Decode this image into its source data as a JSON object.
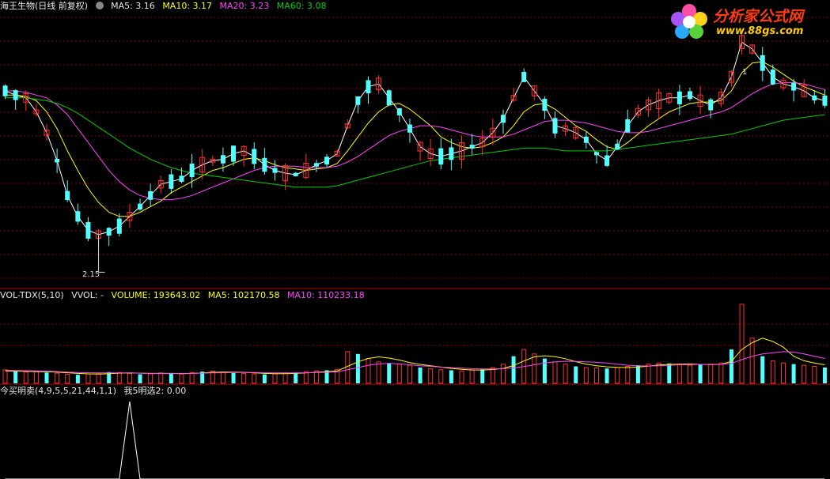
{
  "header_main": {
    "stock_title": "海王生物(日线 前复权)",
    "ma5": "MA5: 3.16",
    "ma10": "MA10: 3.17",
    "ma20": "MA20: 3.23",
    "ma60": "MA60: 3.08"
  },
  "header_volume": {
    "indicator": "VOL-TDX(5,10)",
    "vvol": "VVOL: -",
    "volume": "VOLUME: 193643.02",
    "ma5": "MA5: 102170.58",
    "ma10": "MA10: 110233.18"
  },
  "header_indicator": {
    "name": "今买明卖(4,9,5,5,21,44,1,1)",
    "value": "我5明选2: 0.00"
  },
  "logo": {
    "text": "分析家公式网",
    "url": "www.88gs.com"
  },
  "annotations": {
    "low": "2.15",
    "high": "1"
  },
  "colors": {
    "up": "#ff3030",
    "down": "#54ffff",
    "ma5": "#ffffff",
    "ma10": "#ffff00",
    "ma20": "#ff44ff",
    "ma60": "#00d000",
    "grid": "#8b0000",
    "divider": "#c00000"
  },
  "chart_data": [
    {
      "type": "candlestick",
      "title": "海王生物(日线 前复权)",
      "series": [
        {
          "name": "MA5",
          "color": "#ffffff",
          "values": [
            3.45,
            3.42,
            3.4,
            3.3,
            3.15,
            2.95,
            2.7,
            2.55,
            2.45,
            2.42,
            2.44,
            2.48,
            2.55,
            2.62,
            2.7,
            2.78,
            2.8,
            2.82,
            2.88,
            2.92,
            2.95,
            2.96,
            3.0,
            3.02,
            2.98,
            2.92,
            2.88,
            2.86,
            2.85,
            2.88,
            2.92,
            2.95,
            3.0,
            3.2,
            3.38,
            3.48,
            3.5,
            3.4,
            3.3,
            3.18,
            3.05,
            3.0,
            2.98,
            3.0,
            3.02,
            3.05,
            3.08,
            3.15,
            3.25,
            3.4,
            3.55,
            3.45,
            3.35,
            3.2,
            3.18,
            3.15,
            3.1,
            3.0,
            2.95,
            3.05,
            3.2,
            3.3,
            3.35,
            3.38,
            3.4,
            3.4,
            3.42,
            3.38,
            3.35,
            3.4,
            3.55,
            3.8,
            3.75,
            3.65,
            3.55,
            3.5,
            3.48,
            3.45,
            3.4,
            3.38
          ]
        },
        {
          "name": "MA10",
          "color": "#ffff00",
          "values": [
            3.42,
            3.42,
            3.41,
            3.38,
            3.3,
            3.18,
            3.02,
            2.88,
            2.75,
            2.65,
            2.58,
            2.55,
            2.55,
            2.58,
            2.62,
            2.66,
            2.72,
            2.76,
            2.8,
            2.84,
            2.88,
            2.9,
            2.93,
            2.96,
            2.97,
            2.95,
            2.92,
            2.9,
            2.89,
            2.88,
            2.89,
            2.9,
            2.93,
            3.02,
            3.12,
            3.22,
            3.3,
            3.35,
            3.36,
            3.32,
            3.26,
            3.2,
            3.12,
            3.08,
            3.05,
            3.04,
            3.05,
            3.08,
            3.12,
            3.2,
            3.3,
            3.35,
            3.36,
            3.32,
            3.26,
            3.2,
            3.16,
            3.1,
            3.05,
            3.03,
            3.08,
            3.14,
            3.2,
            3.25,
            3.3,
            3.33,
            3.36,
            3.37,
            3.37,
            3.38,
            3.45,
            3.58,
            3.65,
            3.66,
            3.62,
            3.57,
            3.52,
            3.48,
            3.45,
            3.42
          ]
        },
        {
          "name": "MA20",
          "color": "#ff44ff",
          "values": [
            3.45,
            3.45,
            3.44,
            3.42,
            3.4,
            3.35,
            3.28,
            3.18,
            3.08,
            2.98,
            2.88,
            2.8,
            2.74,
            2.7,
            2.68,
            2.67,
            2.67,
            2.68,
            2.7,
            2.73,
            2.76,
            2.79,
            2.82,
            2.85,
            2.88,
            2.9,
            2.91,
            2.91,
            2.91,
            2.9,
            2.9,
            2.9,
            2.91,
            2.94,
            2.98,
            3.03,
            3.08,
            3.13,
            3.16,
            3.18,
            3.2,
            3.2,
            3.19,
            3.17,
            3.15,
            3.13,
            3.12,
            3.12,
            3.12,
            3.14,
            3.17,
            3.2,
            3.23,
            3.24,
            3.24,
            3.23,
            3.22,
            3.2,
            3.18,
            3.16,
            3.15,
            3.15,
            3.16,
            3.18,
            3.2,
            3.22,
            3.24,
            3.26,
            3.28,
            3.3,
            3.33,
            3.38,
            3.43,
            3.47,
            3.5,
            3.51,
            3.51,
            3.5,
            3.48,
            3.46
          ]
        },
        {
          "name": "MA60",
          "color": "#00d000",
          "values": [
            3.4,
            3.4,
            3.4,
            3.39,
            3.38,
            3.36,
            3.33,
            3.29,
            3.24,
            3.19,
            3.14,
            3.09,
            3.04,
            3.0,
            2.96,
            2.93,
            2.9,
            2.88,
            2.86,
            2.85,
            2.84,
            2.83,
            2.82,
            2.81,
            2.8,
            2.79,
            2.78,
            2.77,
            2.76,
            2.76,
            2.76,
            2.76,
            2.77,
            2.79,
            2.81,
            2.83,
            2.85,
            2.87,
            2.89,
            2.91,
            2.93,
            2.95,
            2.96,
            2.97,
            2.98,
            2.99,
            3.0,
            3.01,
            3.02,
            3.03,
            3.04,
            3.04,
            3.04,
            3.03,
            3.02,
            3.02,
            3.02,
            3.02,
            3.02,
            3.03,
            3.04,
            3.05,
            3.06,
            3.07,
            3.08,
            3.09,
            3.1,
            3.11,
            3.12,
            3.13,
            3.14,
            3.16,
            3.18,
            3.2,
            3.22,
            3.24,
            3.25,
            3.26,
            3.27,
            3.28
          ]
        }
      ],
      "ylim": [
        2.05,
        4.0
      ]
    },
    {
      "type": "bar",
      "title": "VOL-TDX(5,10)",
      "series": [
        {
          "name": "VOLUME",
          "values": [
            60,
            55,
            50,
            52,
            48,
            45,
            40,
            38,
            42,
            45,
            50,
            48,
            44,
            40,
            42,
            46,
            44,
            42,
            48,
            52,
            54,
            50,
            46,
            44,
            42,
            40,
            42,
            46,
            48,
            52,
            55,
            58,
            62,
            140,
            130,
            110,
            95,
            90,
            85,
            80,
            70,
            65,
            60,
            58,
            55,
            60,
            62,
            70,
            85,
            120,
            150,
            130,
            110,
            95,
            85,
            75,
            70,
            68,
            66,
            70,
            75,
            80,
            85,
            90,
            88,
            85,
            80,
            82,
            85,
            90,
            150,
            350,
            200,
            120,
            100,
            90,
            85,
            80,
            75,
            70
          ]
        },
        {
          "name": "MA5",
          "values": [
            55,
            54,
            53,
            52,
            51,
            50,
            47,
            44,
            42,
            41,
            43,
            45,
            46,
            45,
            44,
            44,
            44,
            43,
            44,
            46,
            49,
            50,
            50,
            49,
            47,
            44,
            43,
            43,
            44,
            46,
            49,
            52,
            55,
            75,
            95,
            110,
            117,
            112,
            103,
            92,
            84,
            78,
            72,
            66,
            62,
            59,
            59,
            61,
            66,
            79,
            99,
            117,
            122,
            118,
            109,
            96,
            85,
            78,
            73,
            71,
            70,
            72,
            76,
            81,
            84,
            85,
            86,
            84,
            83,
            84,
            97,
            150,
            180,
            200,
            185,
            160,
            120,
            100,
            90,
            82
          ]
        },
        {
          "name": "MA10",
          "values": [
            58,
            57,
            56,
            55,
            54,
            52,
            50,
            48,
            47,
            46,
            46,
            46,
            46,
            45,
            44,
            44,
            44,
            44,
            44,
            45,
            46,
            47,
            48,
            48,
            48,
            47,
            46,
            46,
            46,
            47,
            48,
            49,
            51,
            60,
            70,
            80,
            86,
            88,
            86,
            82,
            78,
            75,
            72,
            70,
            67,
            65,
            64,
            64,
            65,
            68,
            74,
            82,
            90,
            95,
            98,
            97,
            95,
            93,
            90,
            85,
            80,
            78,
            77,
            78,
            80,
            82,
            83,
            84,
            84,
            85,
            88,
            105,
            120,
            130,
            135,
            140,
            138,
            130,
            120,
            110
          ]
        }
      ]
    },
    {
      "type": "line",
      "title": "今买明卖(4,9,5,5,21,44,1,1)",
      "series": [
        {
          "name": "我5明选2",
          "values": [
            0,
            0,
            0,
            0,
            0,
            0,
            0,
            0,
            0,
            0,
            0,
            0,
            1,
            0,
            0,
            0,
            0,
            0,
            0,
            0,
            0,
            0,
            0,
            0,
            0,
            0,
            0,
            0,
            0,
            0,
            0,
            0,
            0,
            0,
            0,
            0,
            0,
            0,
            0,
            0,
            0,
            0,
            0,
            0,
            0,
            0,
            0,
            0,
            0,
            0,
            0,
            0,
            0,
            0,
            0,
            0,
            0,
            0,
            0,
            0,
            0,
            0,
            0,
            0,
            0,
            0,
            0,
            0,
            0,
            0,
            0,
            0,
            0,
            0,
            0,
            0,
            0,
            0,
            0,
            0
          ]
        }
      ]
    }
  ]
}
